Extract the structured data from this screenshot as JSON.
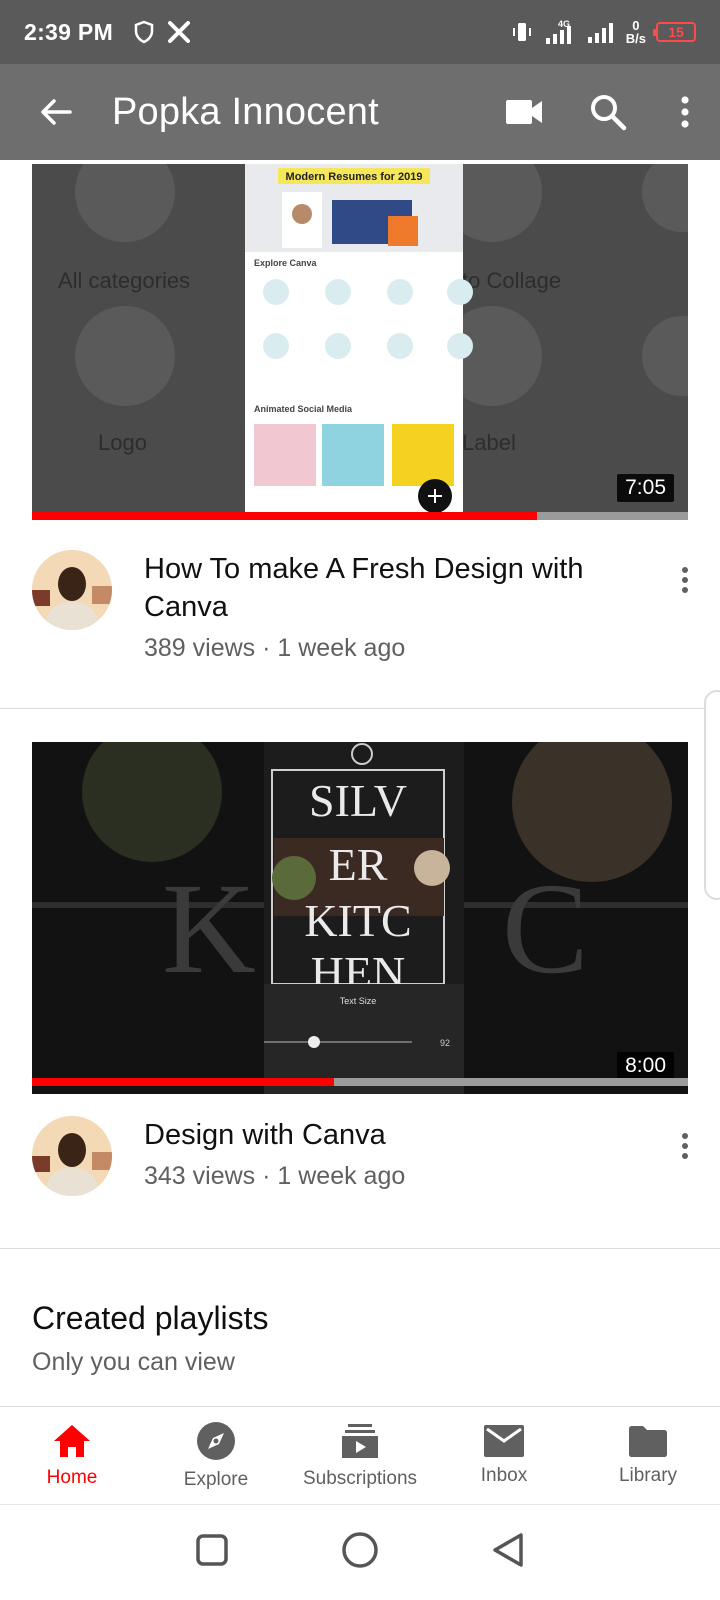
{
  "status_bar": {
    "time": "2:39 PM",
    "network_top": "4G",
    "speed_value": "0",
    "speed_unit": "B/s",
    "battery": "15",
    "battery_color": "#ff4a4a"
  },
  "app_bar": {
    "title": "Popka Innocent",
    "background": "#6e6e6e"
  },
  "videos": [
    {
      "title": "How To make A Fresh Design with Canva",
      "subtitle": "389 views · 1 week ago",
      "duration": "7:05",
      "watched_fraction": 0.77,
      "thumb_header": "Modern Resumes for 2019",
      "thumb_section_1": "Explore Canva",
      "thumb_section_2": "Animated Social Media",
      "thumb_bg_left": "All categories",
      "thumb_bg_logo": "Logo",
      "thumb_bg_collage": "to Collage",
      "thumb_bg_label": "Label"
    },
    {
      "title": "Design with Canva",
      "subtitle": "343 views · 1 week ago",
      "duration": "8:00",
      "watched_fraction": 0.46,
      "thumb_text_1": "SILV",
      "thumb_text_2": "ER",
      "thumb_text_3": "KITC",
      "thumb_text_4": "HEN",
      "thumb_panel": "Text Size",
      "thumb_value": "92"
    }
  ],
  "playlists": {
    "title": "Created playlists",
    "subtitle": "Only you can view"
  },
  "bottom_nav": [
    {
      "label": "Home",
      "icon": "home-icon",
      "active": true
    },
    {
      "label": "Explore",
      "icon": "compass-icon",
      "active": false
    },
    {
      "label": "Subscriptions",
      "icon": "subscriptions-icon",
      "active": false
    },
    {
      "label": "Inbox",
      "icon": "mail-icon",
      "active": false
    },
    {
      "label": "Library",
      "icon": "folder-icon",
      "active": false
    }
  ],
  "colors": {
    "accent": "#ff0000",
    "secondary_text": "#606060"
  }
}
